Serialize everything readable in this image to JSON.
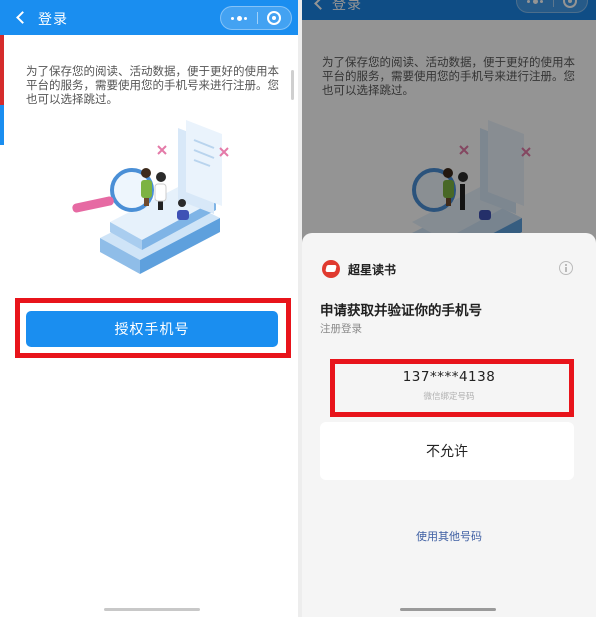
{
  "left": {
    "title": "登录",
    "intro": "为了保存您的阅读、活动数据，便于更好的使用本平台的服务，需要使用您的手机号来进行注册。您也可以选择跳过。",
    "auth_button": "授权手机号"
  },
  "right": {
    "title": "登录",
    "intro": "为了保存您的阅读、活动数据，便于更好的使用本平台的服务，需要使用您的手机号来进行注册。您也可以选择跳过。",
    "app_name": "超星读书",
    "sheet_title": "申请获取并验证你的手机号",
    "sheet_subtitle": "注册登录",
    "phone_number": "137****4138",
    "phone_caption": "微信绑定号码",
    "deny_button": "不允许",
    "other_number": "使用其他号码"
  },
  "colors": {
    "primary_blue": "#1a8ef0",
    "highlight_red": "#e8141b",
    "app_logo_red": "#e03a2f",
    "link_blue": "#3e5fa3"
  },
  "icons": [
    "back-icon",
    "more-icon",
    "close-icon",
    "info-icon",
    "app-logo"
  ]
}
